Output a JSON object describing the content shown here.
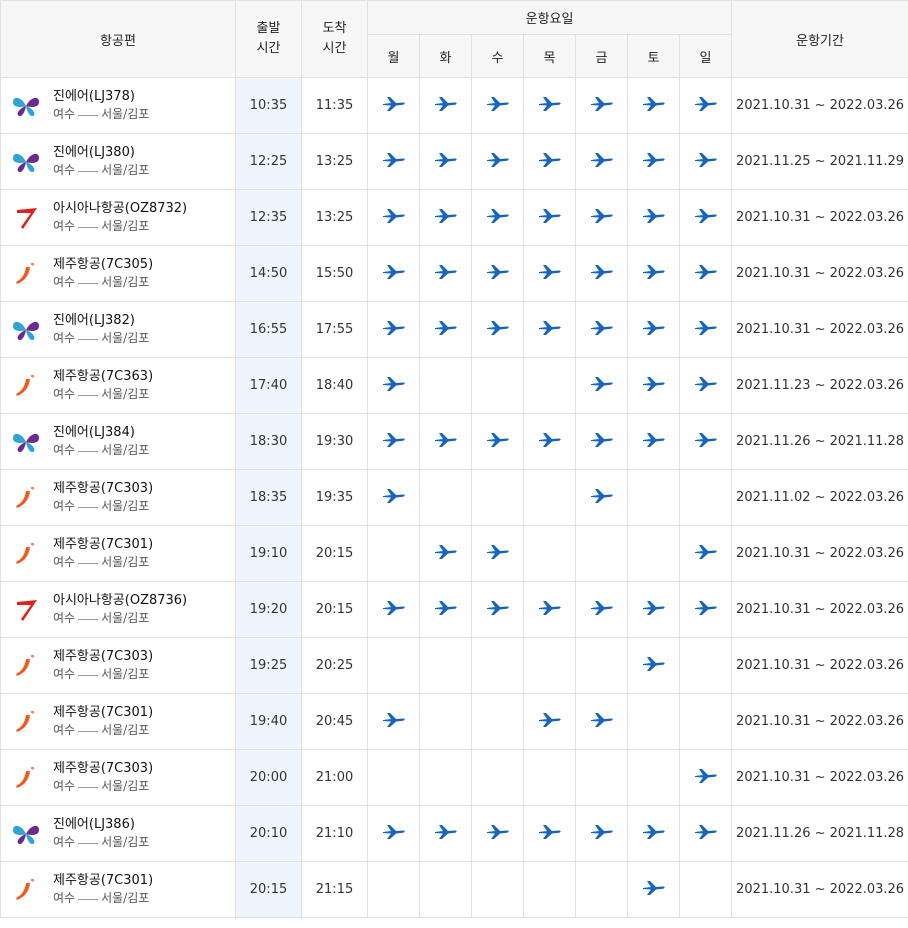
{
  "header": {
    "airline": "항공편",
    "departure": "출발\n시간",
    "arrival": "도착\n시간",
    "days_group": "운항요일",
    "days": [
      "월",
      "화",
      "수",
      "목",
      "금",
      "토",
      "일"
    ],
    "period": "운항기간"
  },
  "colors": {
    "header_bg": "#f7f7f7",
    "departure_bg": "#eef5fd",
    "plane": "#1565c0",
    "jinair": "#6a2c91",
    "asiana": "#e0231c",
    "jeju": "#f15a22"
  },
  "rows": [
    {
      "logo": "jinair-logo-icon",
      "name": "진에어(LJ378)",
      "from": "여수",
      "to": "서울/김포",
      "dep": "10:35",
      "arr": "11:35",
      "days": [
        1,
        1,
        1,
        1,
        1,
        1,
        1
      ],
      "period": "2021.10.31 ~ 2022.03.26"
    },
    {
      "logo": "jinair-logo-icon",
      "name": "진에어(LJ380)",
      "from": "여수",
      "to": "서울/김포",
      "dep": "12:25",
      "arr": "13:25",
      "days": [
        1,
        1,
        1,
        1,
        1,
        1,
        1
      ],
      "period": "2021.11.25 ~ 2021.11.29"
    },
    {
      "logo": "asiana-logo-icon",
      "name": "아시아나항공(OZ8732)",
      "from": "여수",
      "to": "서울/김포",
      "dep": "12:35",
      "arr": "13:25",
      "days": [
        1,
        1,
        1,
        1,
        1,
        1,
        1
      ],
      "period": "2021.10.31 ~ 2022.03.26"
    },
    {
      "logo": "jeju-logo-icon",
      "name": "제주항공(7C305)",
      "from": "여수",
      "to": "서울/김포",
      "dep": "14:50",
      "arr": "15:50",
      "days": [
        1,
        1,
        1,
        1,
        1,
        1,
        1
      ],
      "period": "2021.10.31 ~ 2022.03.26"
    },
    {
      "logo": "jinair-logo-icon",
      "name": "진에어(LJ382)",
      "from": "여수",
      "to": "서울/김포",
      "dep": "16:55",
      "arr": "17:55",
      "days": [
        1,
        1,
        1,
        1,
        1,
        1,
        1
      ],
      "period": "2021.10.31 ~ 2022.03.26"
    },
    {
      "logo": "jeju-logo-icon",
      "name": "제주항공(7C363)",
      "from": "여수",
      "to": "서울/김포",
      "dep": "17:40",
      "arr": "18:40",
      "days": [
        1,
        0,
        0,
        0,
        1,
        1,
        1
      ],
      "period": "2021.11.23 ~ 2022.03.26"
    },
    {
      "logo": "jinair-logo-icon",
      "name": "진에어(LJ384)",
      "from": "여수",
      "to": "서울/김포",
      "dep": "18:30",
      "arr": "19:30",
      "days": [
        1,
        1,
        1,
        1,
        1,
        1,
        1
      ],
      "period": "2021.11.26 ~ 2021.11.28"
    },
    {
      "logo": "jeju-logo-icon",
      "name": "제주항공(7C303)",
      "from": "여수",
      "to": "서울/김포",
      "dep": "18:35",
      "arr": "19:35",
      "days": [
        1,
        0,
        0,
        0,
        1,
        0,
        0
      ],
      "period": "2021.11.02 ~ 2022.03.26"
    },
    {
      "logo": "jeju-logo-icon",
      "name": "제주항공(7C301)",
      "from": "여수",
      "to": "서울/김포",
      "dep": "19:10",
      "arr": "20:15",
      "days": [
        0,
        1,
        1,
        0,
        0,
        0,
        1
      ],
      "period": "2021.10.31 ~ 2022.03.26"
    },
    {
      "logo": "asiana-logo-icon",
      "name": "아시아나항공(OZ8736)",
      "from": "여수",
      "to": "서울/김포",
      "dep": "19:20",
      "arr": "20:15",
      "days": [
        1,
        1,
        1,
        1,
        1,
        1,
        1
      ],
      "period": "2021.10.31 ~ 2022.03.26"
    },
    {
      "logo": "jeju-logo-icon",
      "name": "제주항공(7C303)",
      "from": "여수",
      "to": "서울/김포",
      "dep": "19:25",
      "arr": "20:25",
      "days": [
        0,
        0,
        0,
        0,
        0,
        1,
        0
      ],
      "period": "2021.10.31 ~ 2022.03.26"
    },
    {
      "logo": "jeju-logo-icon",
      "name": "제주항공(7C301)",
      "from": "여수",
      "to": "서울/김포",
      "dep": "19:40",
      "arr": "20:45",
      "days": [
        1,
        0,
        0,
        1,
        1,
        0,
        0
      ],
      "period": "2021.10.31 ~ 2022.03.26"
    },
    {
      "logo": "jeju-logo-icon",
      "name": "제주항공(7C303)",
      "from": "여수",
      "to": "서울/김포",
      "dep": "20:00",
      "arr": "21:00",
      "days": [
        0,
        0,
        0,
        0,
        0,
        0,
        1
      ],
      "period": "2021.10.31 ~ 2022.03.26"
    },
    {
      "logo": "jinair-logo-icon",
      "name": "진에어(LJ386)",
      "from": "여수",
      "to": "서울/김포",
      "dep": "20:10",
      "arr": "21:10",
      "days": [
        1,
        1,
        1,
        1,
        1,
        1,
        1
      ],
      "period": "2021.11.26 ~ 2021.11.28"
    },
    {
      "logo": "jeju-logo-icon",
      "name": "제주항공(7C301)",
      "from": "여수",
      "to": "서울/김포",
      "dep": "20:15",
      "arr": "21:15",
      "days": [
        0,
        0,
        0,
        0,
        0,
        1,
        0
      ],
      "period": "2021.10.31 ~ 2022.03.26"
    }
  ]
}
